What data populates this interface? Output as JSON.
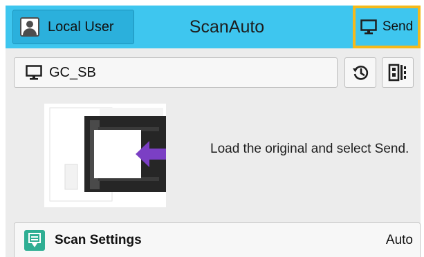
{
  "header": {
    "user_label": "Local User",
    "app_title": "ScanAuto",
    "send_label": "Send",
    "user_icon": "user-icon",
    "send_icon": "monitor-icon"
  },
  "destination": {
    "label": "GC_SB",
    "icon": "monitor-icon",
    "history_icon": "history-icon",
    "sides_icon": "duplex-icon"
  },
  "instruction": {
    "text": "Load the original and select Send."
  },
  "scan_settings": {
    "label": "Scan Settings",
    "value": "Auto",
    "icon": "scan-settings-icon"
  },
  "colors": {
    "header_bg": "#3ec6ef",
    "send_highlight": "#f5b91a",
    "arrow": "#7b3fc4",
    "settings_icon": "#2fae93",
    "panel_bg": "#ececec"
  }
}
